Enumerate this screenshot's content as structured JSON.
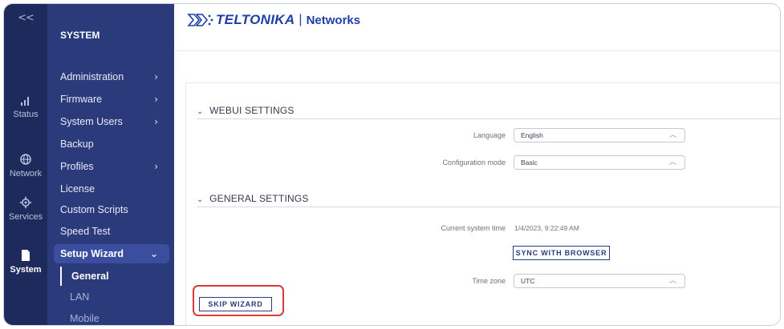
{
  "rail": {
    "collapse_glyph": "<<",
    "items": [
      {
        "label": "Status",
        "icon": "signal-bars-icon"
      },
      {
        "label": "Network",
        "icon": "globe-icon"
      },
      {
        "label": "Services",
        "icon": "gear-icon"
      },
      {
        "label": "System",
        "icon": "system-icon",
        "active": true
      }
    ]
  },
  "submenu": {
    "title": "SYSTEM",
    "items": [
      {
        "label": "Administration",
        "has_children": true
      },
      {
        "label": "Firmware",
        "has_children": true
      },
      {
        "label": "System Users",
        "has_children": true
      },
      {
        "label": "Backup"
      },
      {
        "label": "Profiles",
        "has_children": true
      },
      {
        "label": "License"
      },
      {
        "label": "Custom Scripts"
      },
      {
        "label": "Speed Test"
      },
      {
        "label": "Setup Wizard",
        "expanded": true
      },
      {
        "label": "General",
        "current": true
      },
      {
        "label": "LAN"
      },
      {
        "label": "Mobile"
      }
    ],
    "chevron_right": "›",
    "chevron_down": "⌄"
  },
  "header": {
    "brand": "TELTONIKA",
    "separator": "|",
    "product": "Networks"
  },
  "webui": {
    "heading": "WEBUI SETTINGS",
    "language_label": "Language",
    "language_value": "English",
    "config_label": "Configuration mode",
    "config_value": "Basic"
  },
  "general": {
    "heading": "GENERAL SETTINGS",
    "time_label": "Current system time",
    "time_value": "1/4/2023, 9:22:49 AM",
    "sync_button": "SYNC WITH BROWSER",
    "timezone_label": "Time zone",
    "timezone_value": "UTC"
  },
  "footer": {
    "skip_button": "SKIP WIZARD"
  },
  "colors": {
    "rail_bg": "#1e2a5c",
    "submenu_bg": "#2b3a7a",
    "active_item_bg": "#3a4d9e",
    "brand_blue": "#1e3fa6",
    "highlight_red": "#d63a3a"
  }
}
